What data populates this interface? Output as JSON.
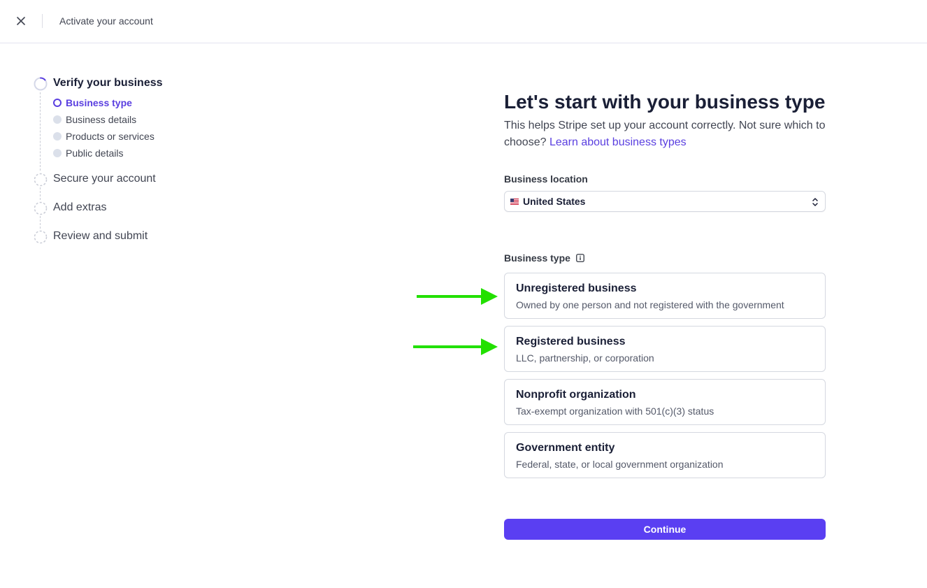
{
  "topbar": {
    "title": "Activate your account",
    "close_icon": "close-icon"
  },
  "stepper": {
    "steps": [
      {
        "label": "Verify your business",
        "state": "active",
        "substeps": [
          {
            "label": "Business type",
            "state": "active"
          },
          {
            "label": "Business details",
            "state": "pending"
          },
          {
            "label": "Products or services",
            "state": "pending"
          },
          {
            "label": "Public details",
            "state": "pending"
          }
        ]
      },
      {
        "label": "Secure your account",
        "state": "pending"
      },
      {
        "label": "Add extras",
        "state": "pending"
      },
      {
        "label": "Review and submit",
        "state": "pending"
      }
    ]
  },
  "main": {
    "title": "Let's start with your business type",
    "subtitle": "This helps Stripe set up your account correctly. Not sure which to choose?",
    "learn_link": "Learn about business types",
    "location": {
      "label": "Business location",
      "value": "United States"
    },
    "business_type": {
      "label": "Business type",
      "options": [
        {
          "title": "Unregistered business",
          "description": "Owned by one person and not registered with the government"
        },
        {
          "title": "Registered business",
          "description": "LLC, partnership, or corporation"
        },
        {
          "title": "Nonprofit organization",
          "description": "Tax-exempt organization with 501(c)(3) status"
        },
        {
          "title": "Government entity",
          "description": "Federal, state, or local government organization"
        }
      ]
    },
    "continue_label": "Continue"
  },
  "colors": {
    "accent": "#5a3ff2",
    "link": "#5a3fe0",
    "annotation_arrow": "#22e000"
  }
}
